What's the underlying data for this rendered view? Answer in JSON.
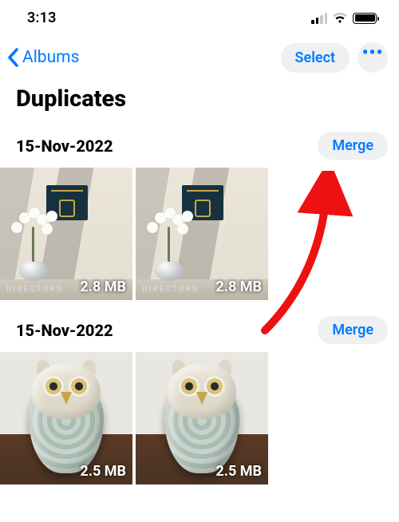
{
  "status": {
    "time": "3:13"
  },
  "nav": {
    "back_label": "Albums",
    "select_label": "Select",
    "more_icon": "more-horizontal-icon"
  },
  "page": {
    "title": "Duplicates"
  },
  "groups": [
    {
      "date": "15-Nov-2022",
      "merge_label": "Merge",
      "items": [
        {
          "size": "2.8 MB",
          "caption": "DIRECTORS"
        },
        {
          "size": "2.8 MB",
          "caption": "DIRECTORS"
        }
      ]
    },
    {
      "date": "15-Nov-2022",
      "merge_label": "Merge",
      "items": [
        {
          "size": "2.5 MB"
        },
        {
          "size": "2.5 MB"
        }
      ]
    }
  ],
  "annotation": {
    "type": "arrow",
    "target": "merge-button-0"
  }
}
